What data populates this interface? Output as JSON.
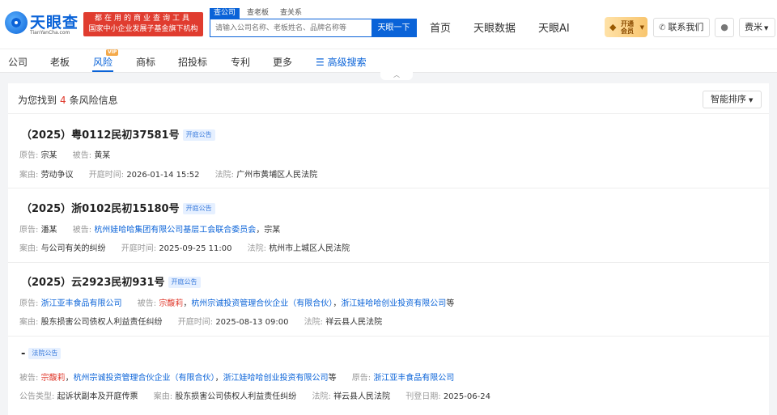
{
  "header": {
    "logo_text": "天眼查",
    "logo_sub": "TianYanCha.com",
    "slogan_line1": "都在用的商业查询工具",
    "slogan_line2": "国家中小企业发展子基金旗下机构",
    "search_tabs": [
      "查公司",
      "查老板",
      "查关系"
    ],
    "search_placeholder": "请输入公司名称、老板姓名、品牌名称等",
    "search_button": "天眼一下",
    "nav": [
      "首页",
      "天眼数据",
      "天眼AI"
    ],
    "vip_line1": "开通",
    "vip_line2": "会员",
    "contact": "联系我们",
    "user": "费米"
  },
  "subnav": {
    "tabs": [
      "公司",
      "老板",
      "风险",
      "商标",
      "招投标",
      "专利",
      "更多"
    ],
    "active_tab": "风险",
    "vip_tag": "VIP",
    "advanced_search": "高级搜索"
  },
  "results": {
    "prefix": "为您找到",
    "count": "4",
    "suffix": "条风险信息",
    "sort_label": "智能排序"
  },
  "cases": [
    {
      "title": "（2025）粤0112民初37581号",
      "tag": "开庭公告",
      "plaintiff_label": "原告:",
      "plaintiff": "宗某",
      "defendant_label": "被告:",
      "defendant": "黄某",
      "cause_label": "案由:",
      "cause": "劳动争议",
      "time_label": "开庭时间:",
      "time": "2026-01-14 15:52",
      "court_label": "法院:",
      "court": "广州市黄埔区人民法院"
    },
    {
      "title": "（2025）浙0102民初15180号",
      "tag": "开庭公告",
      "plaintiff_label": "原告:",
      "plaintiff": "潘某",
      "defendant_label": "被告:",
      "defendant_link": "杭州娃哈哈集团有限公司基层工会联合委员会",
      "defendant_rest": "，宗某",
      "cause_label": "案由:",
      "cause": "与公司有关的纠纷",
      "time_label": "开庭时间:",
      "time": "2025-09-25 11:00",
      "court_label": "法院:",
      "court": "杭州市上城区人民法院"
    },
    {
      "title": "（2025）云2923民初931号",
      "tag": "开庭公告",
      "plaintiff_label": "原告:",
      "plaintiff_link": "浙江亚丰食品有限公司",
      "defendant_label": "被告:",
      "defendant_red": "宗馥莉",
      "comma1": "，",
      "defendant_link1": "杭州宗诚投资管理合伙企业（有限合伙）",
      "comma2": "，",
      "defendant_link2": "浙江娃哈哈创业投资有限公司",
      "defendant_etc": "等",
      "cause_label": "案由:",
      "cause": "股东损害公司债权人利益责任纠纷",
      "time_label": "开庭时间:",
      "time": "2025-08-13 09:00",
      "court_label": "法院:",
      "court": "祥云县人民法院"
    },
    {
      "title": "-",
      "tag": "法院公告",
      "defendant_label": "被告:",
      "defendant_red": "宗馥莉",
      "comma1": "，",
      "defendant_link1": "杭州宗诚投资管理合伙企业（有限合伙）",
      "comma2": "，",
      "defendant_link2": "浙江娃哈哈创业投资有限公司",
      "defendant_etc": "等",
      "plaintiff_label": "原告:",
      "plaintiff_link": "浙江亚丰食品有限公司",
      "type_label": "公告类型:",
      "type": "起诉状副本及开庭传票",
      "cause_label": "案由:",
      "cause": "股东损害公司债权人利益责任纠纷",
      "court_label": "法院:",
      "court": "祥云县人民法院",
      "date_label": "刊登日期:",
      "date": "2025-06-24"
    }
  ]
}
